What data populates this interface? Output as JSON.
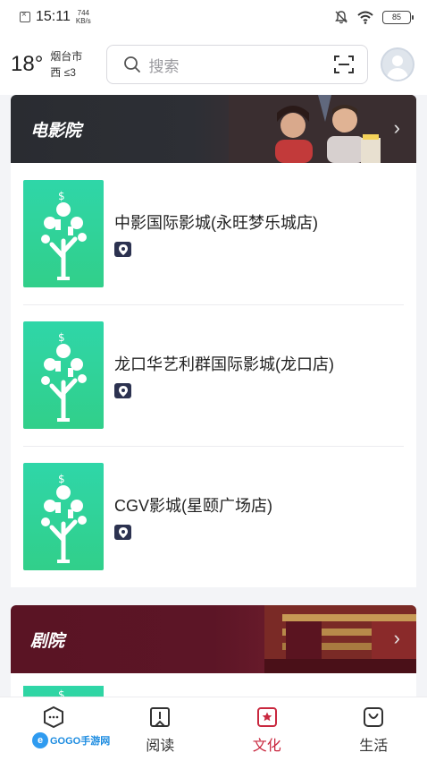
{
  "status": {
    "time": "15:11",
    "net_speed_value": "744",
    "net_speed_unit": "KB/s",
    "battery": "85"
  },
  "header": {
    "temperature": "18°",
    "city": "烟台市",
    "wind": "西 ≤3",
    "search_placeholder": "搜索",
    "icons": [
      "search-icon",
      "scan-icon",
      "avatar"
    ]
  },
  "sections": [
    {
      "title": "电影院",
      "items": [
        {
          "name": "中影国际影城(永旺梦乐城店)"
        },
        {
          "name": "龙口华艺利群国际影城(龙口店)"
        },
        {
          "name": "CGV影城(星颐广场店)"
        }
      ]
    },
    {
      "title": "剧院",
      "items": []
    }
  ],
  "tabbar": {
    "active_color": "#c9283f",
    "items": [
      {
        "label": "",
        "icon": "message-icon"
      },
      {
        "label": "阅读",
        "icon": "book-icon"
      },
      {
        "label": "文化",
        "icon": "star-badge-icon",
        "active": true
      },
      {
        "label": "生活",
        "icon": "bag-icon"
      }
    ]
  },
  "watermark": {
    "logo": "e",
    "text": "GOGO手游网"
  }
}
